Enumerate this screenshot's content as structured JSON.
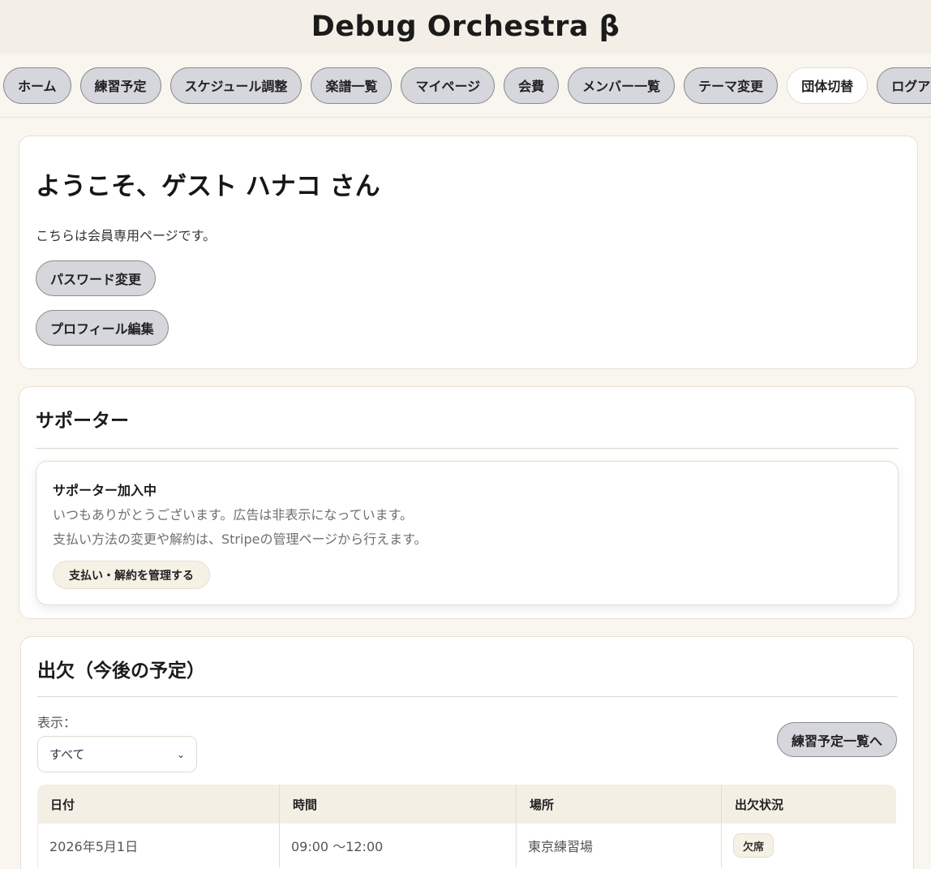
{
  "app": {
    "title": "Debug Orchestra β"
  },
  "nav": {
    "items": [
      {
        "label": "ホーム"
      },
      {
        "label": "練習予定"
      },
      {
        "label": "スケジュール調整"
      },
      {
        "label": "楽譜一覧"
      },
      {
        "label": "マイページ"
      },
      {
        "label": "会費"
      },
      {
        "label": "メンバー一覧"
      },
      {
        "label": "テーマ変更"
      },
      {
        "label": "団体切替"
      },
      {
        "label": "ログアウト"
      }
    ]
  },
  "welcome": {
    "title": "ようこそ、ゲスト ハナコ さん",
    "description": "こちらは会員専用ページです。",
    "change_password_label": "パスワード変更",
    "edit_profile_label": "プロフィール編集"
  },
  "supporter": {
    "title": "サポーター",
    "status": "サポーター加入中",
    "line1": "いつもありがとうございます。広告は非表示になっています。",
    "line2": "支払い方法の変更や解約は、Stripeの管理ページから行えます。",
    "manage_label": "支払い・解約を管理する"
  },
  "attendance": {
    "title": "出欠（今後の予定）",
    "filter_label": "表示：",
    "filter_value": "すべて",
    "schedule_link_label": "練習予定一覧へ",
    "columns": [
      "日付",
      "時間",
      "場所",
      "出欠状況"
    ],
    "rows": [
      {
        "date": "2026年5月1日",
        "time": "09:00 〜12:00",
        "place": "東京練習場",
        "status": "欠席"
      }
    ]
  },
  "colors": {
    "header_bg": "#f3efe7",
    "page_bg": "#f9f6f0",
    "pill_bg": "#d6d7dc",
    "accent_cream": "#f6f1e5"
  },
  "icons": {
    "select_chevron": "chevron-down-icon"
  }
}
